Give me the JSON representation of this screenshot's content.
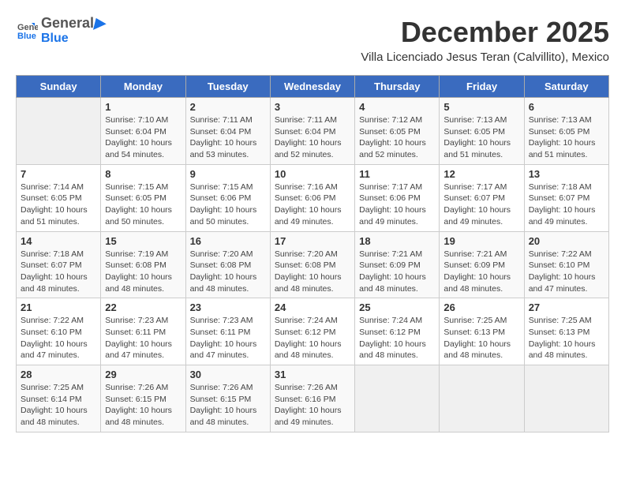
{
  "logo": {
    "line1": "General",
    "line2": "Blue"
  },
  "title": "December 2025",
  "subtitle": "Villa Licenciado Jesus Teran (Calvillito), Mexico",
  "days_of_week": [
    "Sunday",
    "Monday",
    "Tuesday",
    "Wednesday",
    "Thursday",
    "Friday",
    "Saturday"
  ],
  "weeks": [
    [
      {
        "day": "",
        "sunrise": "",
        "sunset": "",
        "daylight": ""
      },
      {
        "day": "1",
        "sunrise": "Sunrise: 7:10 AM",
        "sunset": "Sunset: 6:04 PM",
        "daylight": "Daylight: 10 hours and 54 minutes."
      },
      {
        "day": "2",
        "sunrise": "Sunrise: 7:11 AM",
        "sunset": "Sunset: 6:04 PM",
        "daylight": "Daylight: 10 hours and 53 minutes."
      },
      {
        "day": "3",
        "sunrise": "Sunrise: 7:11 AM",
        "sunset": "Sunset: 6:04 PM",
        "daylight": "Daylight: 10 hours and 52 minutes."
      },
      {
        "day": "4",
        "sunrise": "Sunrise: 7:12 AM",
        "sunset": "Sunset: 6:05 PM",
        "daylight": "Daylight: 10 hours and 52 minutes."
      },
      {
        "day": "5",
        "sunrise": "Sunrise: 7:13 AM",
        "sunset": "Sunset: 6:05 PM",
        "daylight": "Daylight: 10 hours and 51 minutes."
      },
      {
        "day": "6",
        "sunrise": "Sunrise: 7:13 AM",
        "sunset": "Sunset: 6:05 PM",
        "daylight": "Daylight: 10 hours and 51 minutes."
      }
    ],
    [
      {
        "day": "7",
        "sunrise": "Sunrise: 7:14 AM",
        "sunset": "Sunset: 6:05 PM",
        "daylight": "Daylight: 10 hours and 51 minutes."
      },
      {
        "day": "8",
        "sunrise": "Sunrise: 7:15 AM",
        "sunset": "Sunset: 6:05 PM",
        "daylight": "Daylight: 10 hours and 50 minutes."
      },
      {
        "day": "9",
        "sunrise": "Sunrise: 7:15 AM",
        "sunset": "Sunset: 6:06 PM",
        "daylight": "Daylight: 10 hours and 50 minutes."
      },
      {
        "day": "10",
        "sunrise": "Sunrise: 7:16 AM",
        "sunset": "Sunset: 6:06 PM",
        "daylight": "Daylight: 10 hours and 49 minutes."
      },
      {
        "day": "11",
        "sunrise": "Sunrise: 7:17 AM",
        "sunset": "Sunset: 6:06 PM",
        "daylight": "Daylight: 10 hours and 49 minutes."
      },
      {
        "day": "12",
        "sunrise": "Sunrise: 7:17 AM",
        "sunset": "Sunset: 6:07 PM",
        "daylight": "Daylight: 10 hours and 49 minutes."
      },
      {
        "day": "13",
        "sunrise": "Sunrise: 7:18 AM",
        "sunset": "Sunset: 6:07 PM",
        "daylight": "Daylight: 10 hours and 49 minutes."
      }
    ],
    [
      {
        "day": "14",
        "sunrise": "Sunrise: 7:18 AM",
        "sunset": "Sunset: 6:07 PM",
        "daylight": "Daylight: 10 hours and 48 minutes."
      },
      {
        "day": "15",
        "sunrise": "Sunrise: 7:19 AM",
        "sunset": "Sunset: 6:08 PM",
        "daylight": "Daylight: 10 hours and 48 minutes."
      },
      {
        "day": "16",
        "sunrise": "Sunrise: 7:20 AM",
        "sunset": "Sunset: 6:08 PM",
        "daylight": "Daylight: 10 hours and 48 minutes."
      },
      {
        "day": "17",
        "sunrise": "Sunrise: 7:20 AM",
        "sunset": "Sunset: 6:08 PM",
        "daylight": "Daylight: 10 hours and 48 minutes."
      },
      {
        "day": "18",
        "sunrise": "Sunrise: 7:21 AM",
        "sunset": "Sunset: 6:09 PM",
        "daylight": "Daylight: 10 hours and 48 minutes."
      },
      {
        "day": "19",
        "sunrise": "Sunrise: 7:21 AM",
        "sunset": "Sunset: 6:09 PM",
        "daylight": "Daylight: 10 hours and 48 minutes."
      },
      {
        "day": "20",
        "sunrise": "Sunrise: 7:22 AM",
        "sunset": "Sunset: 6:10 PM",
        "daylight": "Daylight: 10 hours and 47 minutes."
      }
    ],
    [
      {
        "day": "21",
        "sunrise": "Sunrise: 7:22 AM",
        "sunset": "Sunset: 6:10 PM",
        "daylight": "Daylight: 10 hours and 47 minutes."
      },
      {
        "day": "22",
        "sunrise": "Sunrise: 7:23 AM",
        "sunset": "Sunset: 6:11 PM",
        "daylight": "Daylight: 10 hours and 47 minutes."
      },
      {
        "day": "23",
        "sunrise": "Sunrise: 7:23 AM",
        "sunset": "Sunset: 6:11 PM",
        "daylight": "Daylight: 10 hours and 47 minutes."
      },
      {
        "day": "24",
        "sunrise": "Sunrise: 7:24 AM",
        "sunset": "Sunset: 6:12 PM",
        "daylight": "Daylight: 10 hours and 48 minutes."
      },
      {
        "day": "25",
        "sunrise": "Sunrise: 7:24 AM",
        "sunset": "Sunset: 6:12 PM",
        "daylight": "Daylight: 10 hours and 48 minutes."
      },
      {
        "day": "26",
        "sunrise": "Sunrise: 7:25 AM",
        "sunset": "Sunset: 6:13 PM",
        "daylight": "Daylight: 10 hours and 48 minutes."
      },
      {
        "day": "27",
        "sunrise": "Sunrise: 7:25 AM",
        "sunset": "Sunset: 6:13 PM",
        "daylight": "Daylight: 10 hours and 48 minutes."
      }
    ],
    [
      {
        "day": "28",
        "sunrise": "Sunrise: 7:25 AM",
        "sunset": "Sunset: 6:14 PM",
        "daylight": "Daylight: 10 hours and 48 minutes."
      },
      {
        "day": "29",
        "sunrise": "Sunrise: 7:26 AM",
        "sunset": "Sunset: 6:15 PM",
        "daylight": "Daylight: 10 hours and 48 minutes."
      },
      {
        "day": "30",
        "sunrise": "Sunrise: 7:26 AM",
        "sunset": "Sunset: 6:15 PM",
        "daylight": "Daylight: 10 hours and 48 minutes."
      },
      {
        "day": "31",
        "sunrise": "Sunrise: 7:26 AM",
        "sunset": "Sunset: 6:16 PM",
        "daylight": "Daylight: 10 hours and 49 minutes."
      },
      {
        "day": "",
        "sunrise": "",
        "sunset": "",
        "daylight": ""
      },
      {
        "day": "",
        "sunrise": "",
        "sunset": "",
        "daylight": ""
      },
      {
        "day": "",
        "sunrise": "",
        "sunset": "",
        "daylight": ""
      }
    ]
  ]
}
